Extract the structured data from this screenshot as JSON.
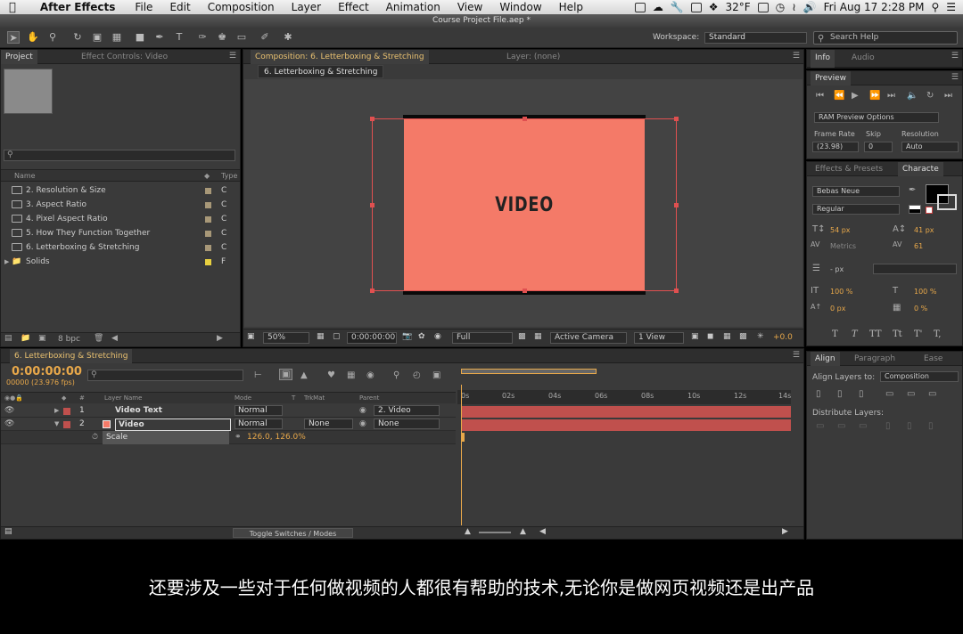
{
  "menubar": {
    "app": "After Effects",
    "items": [
      "File",
      "Edit",
      "Composition",
      "Layer",
      "Effect",
      "Animation",
      "View",
      "Window",
      "Help"
    ],
    "temperature": "32°F",
    "clock": "Fri Aug 17  2:28 PM"
  },
  "window_title": "Course Project File.aep *",
  "toolbar": {
    "workspace_label": "Workspace:",
    "workspace_value": "Standard",
    "help_placeholder": "Search Help"
  },
  "project": {
    "tab_project": "Project",
    "tab_effects": "Effect Controls: Video",
    "col_name": "Name",
    "col_type": "Type",
    "items": [
      {
        "label": "2. Resolution & Size",
        "type": "C",
        "swatch": "#a89878"
      },
      {
        "label": "3. Aspect Ratio",
        "type": "C",
        "swatch": "#a89878"
      },
      {
        "label": "4. Pixel Aspect Ratio",
        "type": "C",
        "swatch": "#a89878"
      },
      {
        "label": "5. How They Function Together",
        "type": "C",
        "swatch": "#a89878"
      },
      {
        "label": "6. Letterboxing & Stretching",
        "type": "C",
        "swatch": "#a89878"
      },
      {
        "label": "Solids",
        "type": "F",
        "swatch": "#e8d040"
      }
    ],
    "bpc": "8 bpc"
  },
  "composition": {
    "tab": "Composition: 6. Letterboxing & Stretching",
    "layer_tab": "Layer: (none)",
    "sub_tab": "6. Letterboxing & Stretching",
    "video_text": "VIDEO",
    "zoom": "50%",
    "timecode": "0:00:00:00",
    "resolution": "Full",
    "camera": "Active Camera",
    "views": "1 View",
    "exposure": "+0.0"
  },
  "info": {
    "tab_info": "Info",
    "tab_audio": "Audio"
  },
  "preview": {
    "tab": "Preview",
    "ram_options": "RAM Preview Options",
    "frame_rate_label": "Frame Rate",
    "skip_label": "Skip",
    "resolution_label": "Resolution",
    "frame_rate_value": "(23.98)",
    "skip_value": "0",
    "resolution_value": "Auto"
  },
  "character": {
    "tab_effects": "Effects & Presets",
    "tab_character": "Characte",
    "font": "Bebas Neue",
    "style": "Regular",
    "size": "54 px",
    "leading": "41 px",
    "kerning": "Metrics",
    "tracking": "61",
    "stroke": "- px",
    "vscale": "100 %",
    "hscale": "100 %",
    "baseline": "0 px",
    "tsume": "0 %",
    "styles": [
      "T",
      "T",
      "TT",
      "Tt",
      "T'",
      "T,"
    ],
    "fill_color": "#000000"
  },
  "align": {
    "tab_align": "Align",
    "tab_paragraph": "Paragraph",
    "tab_ease": "Ease",
    "align_to_label": "Align Layers to:",
    "align_to_value": "Composition",
    "distribute_label": "Distribute Layers:"
  },
  "timeline": {
    "tab": "6. Letterboxing & Stretching",
    "timecode": "0:00:00:00",
    "fps": "00000 (23.976 fps)",
    "headers": {
      "layer_name": "Layer Name",
      "mode": "Mode",
      "t": "T",
      "trkmat": "TrkMat",
      "parent": "Parent"
    },
    "layers": [
      {
        "num": "1",
        "name": "Video Text",
        "mode": "Normal",
        "trkmat": "",
        "parent": "2. Video",
        "color": "#c0504d"
      },
      {
        "num": "2",
        "name": "Video",
        "mode": "Normal",
        "trkmat": "None",
        "parent": "None",
        "color": "#f47a68"
      }
    ],
    "property_name": "Scale",
    "scale_value": "126.0, 126.0%",
    "ruler": [
      "0s",
      "02s",
      "04s",
      "06s",
      "08s",
      "10s",
      "12s",
      "14s"
    ],
    "toggle_label": "Toggle Switches / Modes"
  },
  "subtitle": "还要涉及一些对于任何做视频的人都很有帮助的技术,无论你是做网页视频还是出产品"
}
